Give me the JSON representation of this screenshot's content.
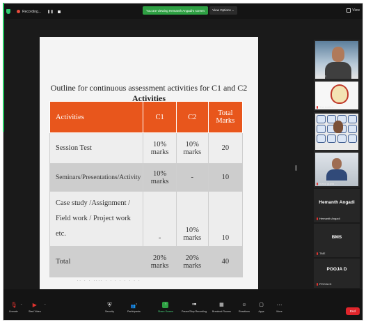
{
  "topbar": {
    "recording_label": "Recording...",
    "pause_glyph": "❚❚",
    "sharing_banner": "You are viewing Hemanth Angadi's screen",
    "view_options_label": "View Options ⌄",
    "view_label": "View"
  },
  "slide": {
    "title_text": "Outline for continuous assessment activities for C1 and C2",
    "title_bold": "Activities",
    "table": {
      "headers": [
        "Activities",
        "C1",
        "C2",
        "Total Marks"
      ],
      "rows": [
        [
          "Session Test",
          "10% marks",
          "10% marks",
          "20"
        ],
        [
          "Seminars/Presentations/Activity",
          "10% marks",
          "-",
          "10"
        ],
        [
          "Case study /Assignment / Field work / Project work etc.",
          "-",
          "10% marks",
          "10"
        ],
        [
          "Total",
          "20% marks",
          "20% marks",
          "40"
        ]
      ]
    },
    "footer_text": "..  .  .  ....   .  .   .  .  .      .  .  ."
  },
  "participants": [
    {
      "label": "VSH HE",
      "kind": "video"
    },
    {
      "label": "The Institut...",
      "kind": "video"
    },
    {
      "label": "akash Jame",
      "kind": "video"
    },
    {
      "label": "manu gupta ...",
      "kind": "video"
    },
    {
      "big_name": "Hemanth Angadi",
      "label": "Hemanth Angadi",
      "kind": "name"
    },
    {
      "big_name": "BMS",
      "label": "TME",
      "kind": "name"
    },
    {
      "big_name": "POOJA D",
      "label": "POOJA D",
      "kind": "name"
    }
  ],
  "toolbar": {
    "unmute": "Unmute",
    "start_video": "Start Video",
    "security": "Security",
    "participants": "Participants",
    "participants_count": "7",
    "share_screen": "Share Screen",
    "pause_stop_recording": "Pause/Stop Recording",
    "breakout_rooms": "Breakout Rooms",
    "reactions": "Reactions",
    "apps": "Apps",
    "more": "More",
    "end": "End"
  },
  "colors": {
    "accent_green": "#2ea043",
    "table_header": "#e8561c",
    "end_red": "#e0252b"
  }
}
